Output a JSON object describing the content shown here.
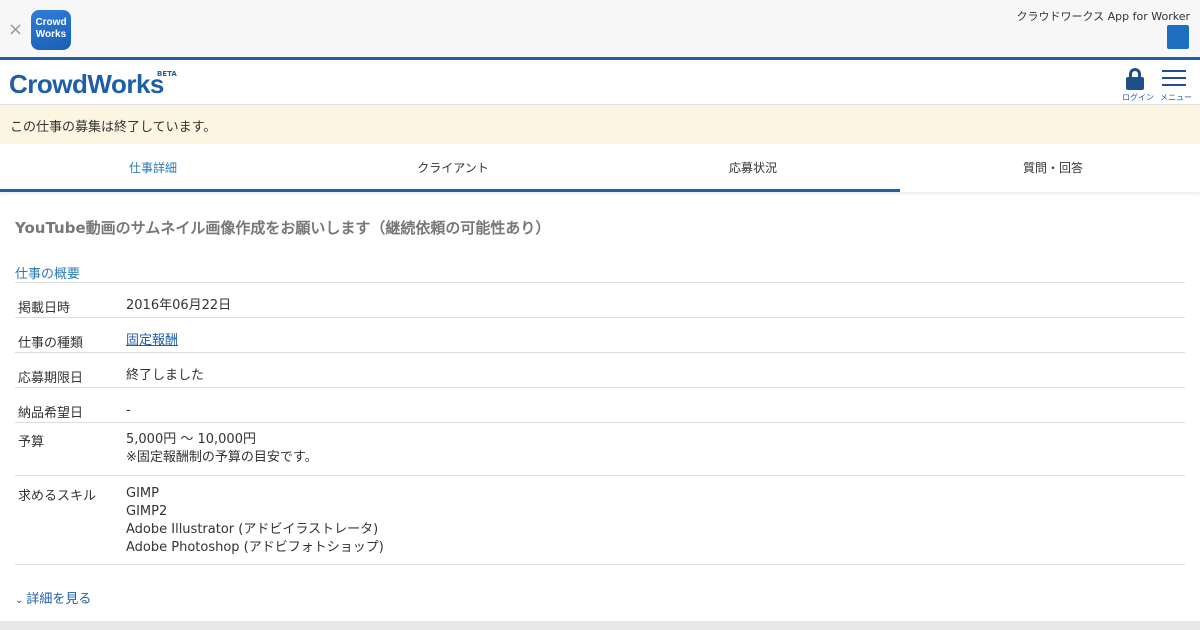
{
  "banner": {
    "close_glyph": "×",
    "app_icon_line1": "Crowd",
    "app_icon_line2": "Works",
    "text": "クラウドワークス App for Worker"
  },
  "header": {
    "logo": "CrowdWorks",
    "beta": "BETA",
    "login_label": "ログイン",
    "menu_label": "メニュー"
  },
  "notice": {
    "text": "この仕事の募集は終了しています。"
  },
  "tabs": [
    {
      "label": "仕事詳細"
    },
    {
      "label": "クライアント"
    },
    {
      "label": "応募状況"
    },
    {
      "label": "質問・回答"
    }
  ],
  "job": {
    "title": "YouTube動画のサムネイル画像作成をお願いします（継続依頼の可能性あり）",
    "section_title": "仕事の概要",
    "rows": [
      {
        "label": "掲載日時",
        "value": "2016年06月22日"
      },
      {
        "label": "仕事の種類",
        "value": "固定報酬"
      },
      {
        "label": "応募期限日",
        "value": "終了しました"
      },
      {
        "label": "納品希望日",
        "value": "-"
      }
    ],
    "budget_label": "予算",
    "budget_value": "5,000円 〜 10,000円",
    "budget_note": "※固定報酬制の予算の目安です。",
    "skills_label": "求めるスキル",
    "skills": [
      "GIMP",
      "GIMP2",
      "Adobe Illustrator (アドビイラストレータ)",
      "Adobe Photoshop (アドビフォトショップ)"
    ],
    "toggle_label": "詳細を見る"
  },
  "colors": {
    "brand": "#1f5fa8",
    "link": "#2a7ab5",
    "notice_bg": "#fcf5e1"
  },
  "icons": [
    "close-icon",
    "app-icon",
    "lock-icon",
    "hamburger-menu-icon",
    "chevron-down-icon"
  ]
}
